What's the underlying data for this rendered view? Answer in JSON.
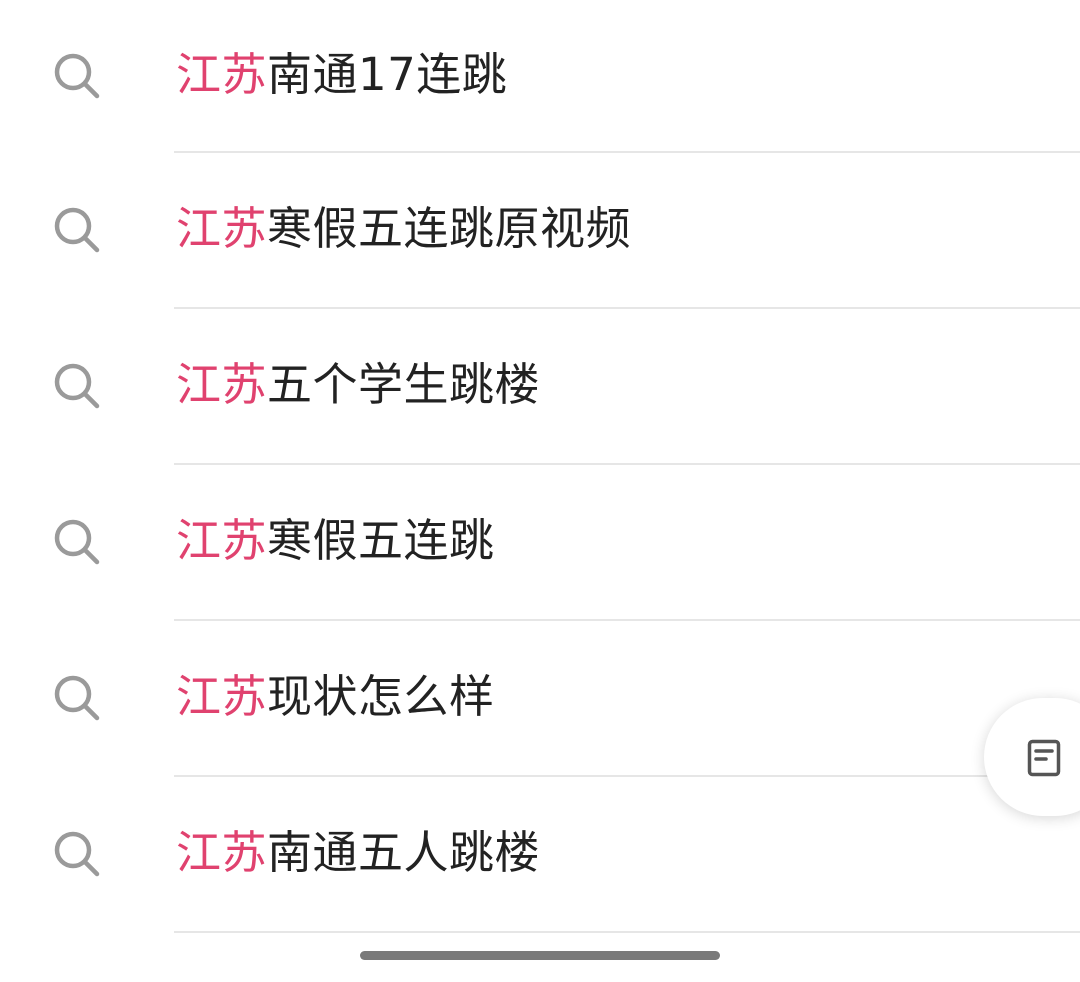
{
  "suggestions": [
    {
      "highlight": "江苏",
      "rest": "南通17连跳",
      "icon": "search-icon"
    },
    {
      "highlight": "江苏",
      "rest": "寒假五连跳原视频",
      "icon": "search-icon"
    },
    {
      "highlight": "江苏",
      "rest": "五个学生跳楼",
      "icon": "search-icon"
    },
    {
      "highlight": "江苏",
      "rest": "寒假五连跳",
      "icon": "search-icon"
    },
    {
      "highlight": "江苏",
      "rest": "现状怎么样",
      "icon": "search-icon"
    },
    {
      "highlight": "江苏",
      "rest": "南通五人跳楼",
      "icon": "search-icon"
    }
  ],
  "floating_button": {
    "icon": "document-icon"
  },
  "colors": {
    "highlight": "#e0426f",
    "text": "#222222",
    "icon": "#9a9a9a",
    "divider": "#e6e6e6"
  }
}
